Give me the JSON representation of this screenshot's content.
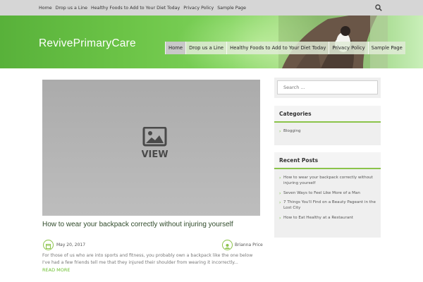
{
  "topbar": {
    "nav": [
      "Home",
      "Drop us a Line",
      "Healthy Foods to Add to Your Diet Today",
      "Privacy Policy",
      "Sample Page"
    ],
    "search_icon": "search-icon"
  },
  "header": {
    "site_title": "RevivePrimaryCare",
    "nav": [
      "Home",
      "Drop us a Line",
      "Healthy Foods to Add to Your Diet Today",
      "Privacy Policy",
      "Sample Page"
    ],
    "active_nav": "Home"
  },
  "post": {
    "thumbnail_label": "VIEW",
    "title": "How to wear your backpack correctly without injuring yourself",
    "date": "May 20, 2017",
    "author": "Brianna Price",
    "excerpt": "For those of us who are into sports and fitness, you probably own a backpack like the one below   I've had a few friends tell me that they injured their shoulder from wearing it incorrectly...",
    "read_more": "READ MORE"
  },
  "sidebar": {
    "search_placeholder": "Search ...",
    "categories_title": "Categories",
    "categories": [
      "Blogging"
    ],
    "recent_title": "Recent Posts",
    "recent_posts": [
      "How to wear your backpack correctly without injuring yourself",
      "Seven Ways to Feel Like More of a Man",
      "7 Things You'll Find on a Beauty Pageant in the Lost City",
      "How to Eat Healthy at a Restaurant"
    ]
  },
  "colors": {
    "accent": "#8bc34a",
    "link": "#6bbf2d",
    "header_green": "#6cc447"
  }
}
